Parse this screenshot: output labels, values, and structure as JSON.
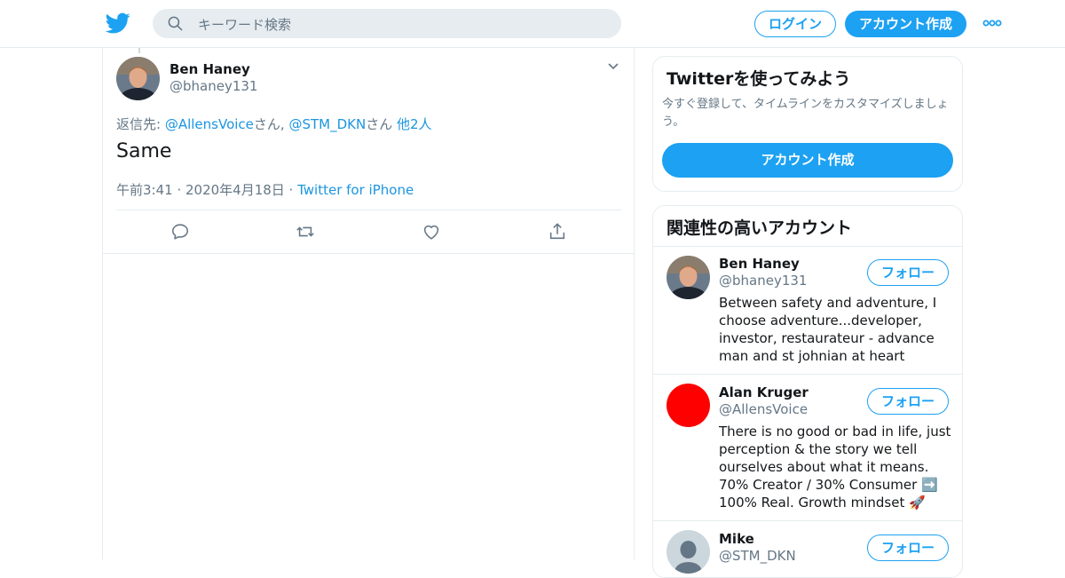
{
  "header": {
    "search_placeholder": "キーワード検索",
    "login_label": "ログイン",
    "signup_label": "アカウント作成"
  },
  "colors": {
    "accent": "#1da1f2",
    "link": "#1b95e0",
    "secondary_text": "#657786",
    "border": "#e6ecf0"
  },
  "tweet": {
    "author_name": "Ben Haney",
    "author_handle": "@bhaney131",
    "reply_prefix": "返信先: ",
    "reply_user1": "@AllensVoice",
    "reply_sep1": "さん, ",
    "reply_user2": "@STM_DKN",
    "reply_sep2": "さん ",
    "reply_others": "他2人",
    "text": "Same",
    "time": "午前3:41 · 2020年4月18日 · ",
    "source": "Twitter for iPhone",
    "actions": [
      "reply-icon",
      "retweet-icon",
      "like-icon",
      "share-icon"
    ]
  },
  "signup_card": {
    "title": "Twitterを使ってみよう",
    "description": "今すぐ登録して、タイムラインをカスタマイズしましょう。",
    "button_label": "アカウント作成"
  },
  "related": {
    "title": "関連性の高いアカウント",
    "follow_label": "フォロー",
    "accounts": [
      {
        "name": "Ben Haney",
        "handle": "@bhaney131",
        "bio": "Between safety and adventure, I choose adventure...developer, investor, restaurateur - advance man and st johnian at heart"
      },
      {
        "name": "Alan Kruger",
        "handle": "@AllensVoice",
        "bio": "There is no good or bad in life, just perception & the story we tell ourselves about what it means. 70% Creator / 30% Consumer ➡️ 100% Real. Growth mindset 🚀"
      },
      {
        "name": "Mike",
        "handle": "@STM_DKN",
        "bio": ""
      }
    ]
  }
}
